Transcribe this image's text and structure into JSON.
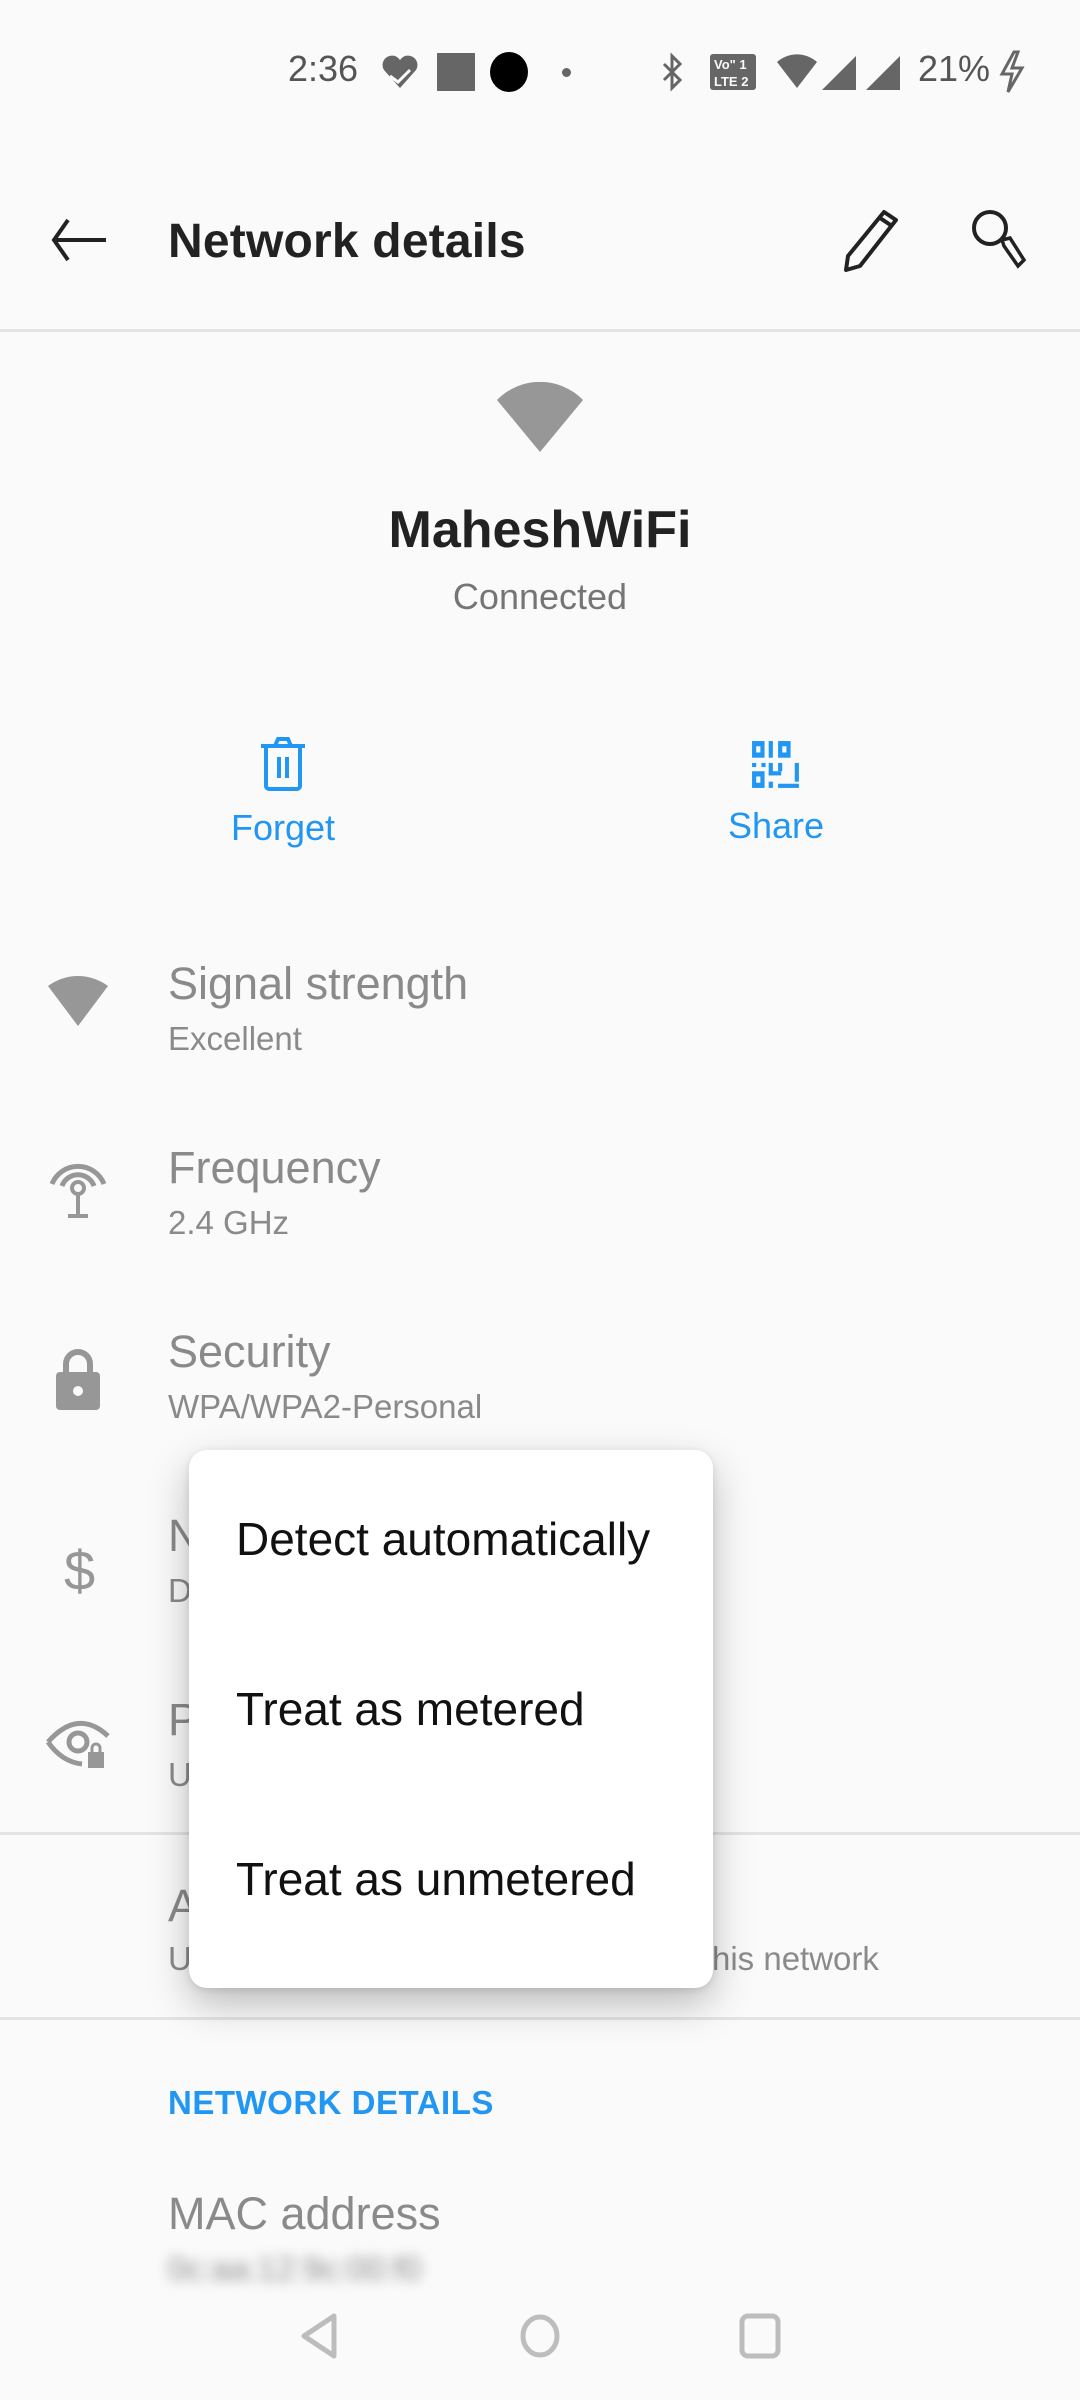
{
  "status_bar": {
    "time": "2:36",
    "battery_percent": "21%",
    "left_icons": [
      "health-heart-icon",
      "app-square-icon",
      "circle-icon",
      "dot-icon"
    ],
    "right_icons": [
      "bluetooth-icon",
      "volte-lte-icon",
      "wifi-icon",
      "signal-icon",
      "signal-icon",
      "charging-icon"
    ]
  },
  "toolbar": {
    "title": "Network details",
    "back_icon": "arrow-back-icon",
    "edit_icon": "pencil-icon",
    "search_icon": "search-icon"
  },
  "network": {
    "name": "MaheshWiFi",
    "status": "Connected"
  },
  "actions": [
    {
      "label": "Forget",
      "icon": "trash-icon"
    },
    {
      "label": "Share",
      "icon": "qr-code-icon"
    }
  ],
  "rows": [
    {
      "title": "Signal strength",
      "subtitle": "Excellent",
      "icon": "wifi-icon"
    },
    {
      "title": "Frequency",
      "subtitle": "2.4 GHz",
      "icon": "antenna-icon"
    },
    {
      "title": "Security",
      "subtitle": "WPA/WPA2-Personal",
      "icon": "lock-icon"
    },
    {
      "title": "N",
      "subtitle": "D",
      "icon": "dollar-icon"
    },
    {
      "title": "P",
      "subtitle": "U",
      "icon": "privacy-eye-lock-icon"
    },
    {
      "title": "A",
      "subtitle": "U",
      "subtitle_tail": "his network"
    }
  ],
  "section": {
    "header": "NETWORK DETAILS"
  },
  "mac": {
    "title": "MAC address",
    "value_blurred": "0c:aa:12:9c:00:f0"
  },
  "popup_menu": {
    "options": [
      "Detect automatically",
      "Treat as metered",
      "Treat as unmetered"
    ]
  },
  "nav_bar": {
    "buttons": [
      "back",
      "home",
      "recents"
    ]
  },
  "colors": {
    "accent": "#2196f3",
    "background": "#fafafa",
    "icon_gray": "#969696"
  }
}
